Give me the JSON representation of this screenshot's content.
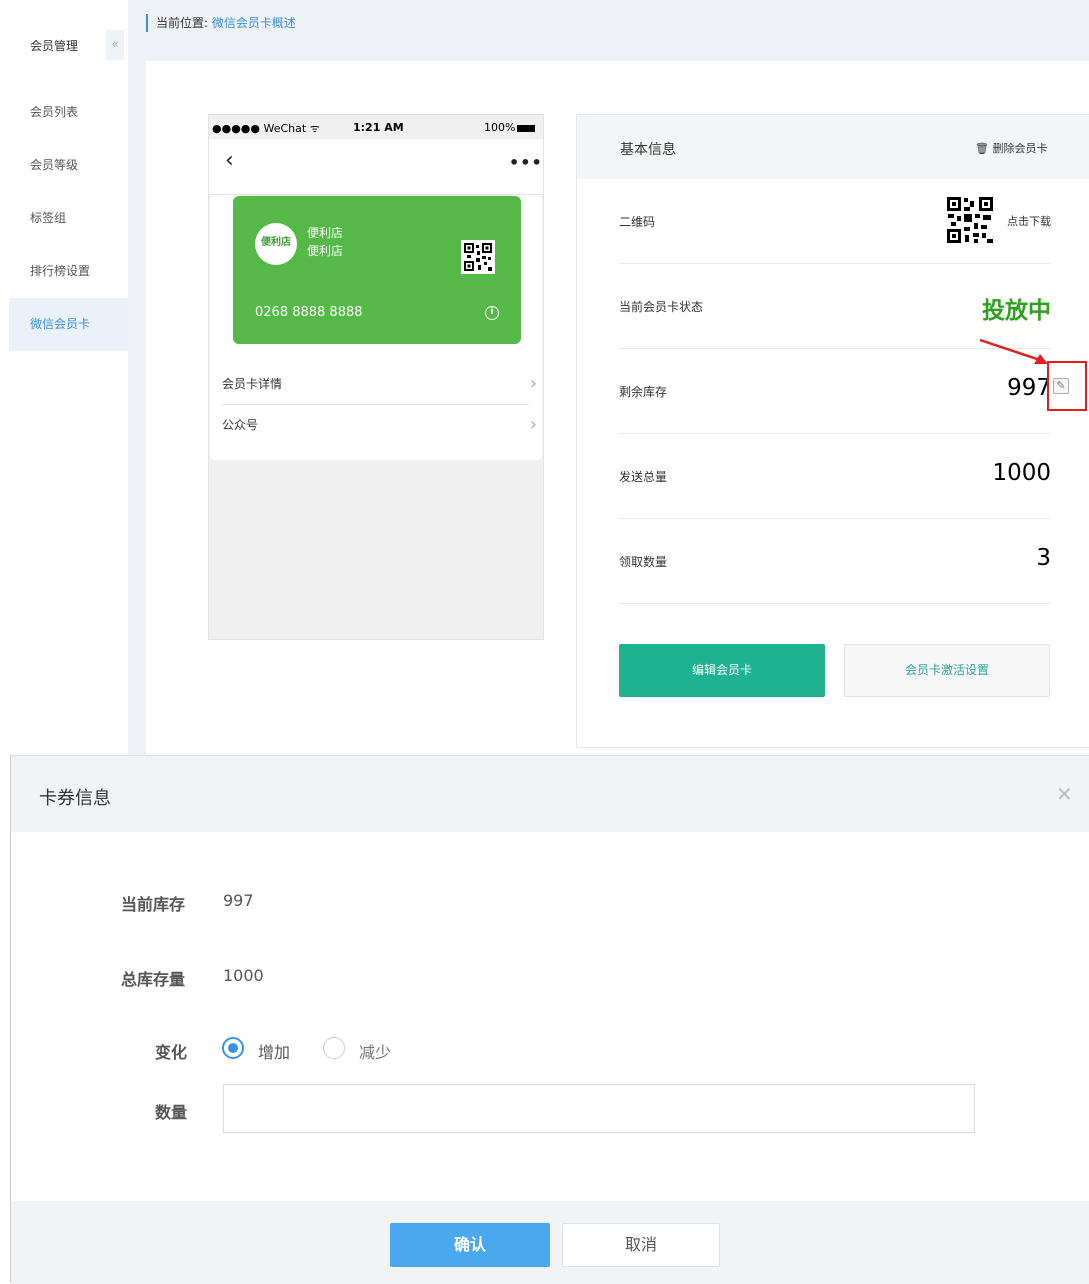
{
  "sidebar": {
    "title": "会员管理",
    "collapse_icon": "«",
    "items": [
      {
        "label": "会员列表"
      },
      {
        "label": "会员等级"
      },
      {
        "label": "标签组"
      },
      {
        "label": "排行榜设置"
      },
      {
        "label": "微信会员卡",
        "active": true
      }
    ]
  },
  "breadcrumb": {
    "prefix": "当前位置:",
    "current": "微信会员卡概述"
  },
  "phone": {
    "status_left": "●●●●● WeChat ᯤ",
    "time": "1:21 AM",
    "battery": "100%",
    "back_icon": "‹",
    "more_icon": "•••",
    "card": {
      "logo_text": "便利店",
      "name_line1": "便利店",
      "name_line2": "便利店",
      "number": "0268 8888 8888",
      "info_icon": "i",
      "color": "#55b948"
    },
    "rows": [
      {
        "label": "会员卡详情"
      },
      {
        "label": "公众号"
      }
    ]
  },
  "info": {
    "title": "基本信息",
    "delete_label": "删除会员卡",
    "qr_label": "二维码",
    "qr_download": "点击下载",
    "status_label": "当前会员卡状态",
    "status_value": "投放中",
    "stock_label": "剩余库存",
    "stock_value": "997",
    "sent_label": "发送总量",
    "sent_value": "1000",
    "received_label": "领取数量",
    "received_value": "3",
    "edit_button": "编辑会员卡",
    "activate_button": "会员卡激活设置",
    "accent_color": "#1fb290"
  },
  "modal": {
    "title": "卡券信息",
    "close_icon": "✕",
    "current_stock_label": "当前库存",
    "current_stock_value": "997",
    "total_stock_label": "总库存量",
    "total_stock_value": "1000",
    "change_label": "变化",
    "option_increase": "增加",
    "option_decrease": "减少",
    "selected_option": "增加",
    "quantity_label": "数量",
    "quantity_value": "",
    "confirm_button": "确认",
    "cancel_button": "取消"
  }
}
